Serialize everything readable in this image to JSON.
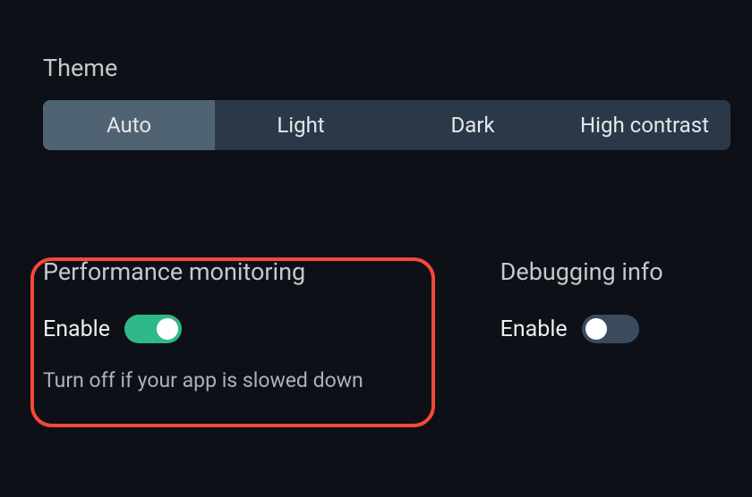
{
  "theme": {
    "title": "Theme",
    "options": {
      "auto": "Auto",
      "light": "Light",
      "dark": "Dark",
      "high_contrast": "High contrast"
    }
  },
  "performance": {
    "title": "Performance monitoring",
    "enable_label": "Enable",
    "helper": "Turn off if your app is slowed down"
  },
  "debugging": {
    "title": "Debugging info",
    "enable_label": "Enable"
  }
}
